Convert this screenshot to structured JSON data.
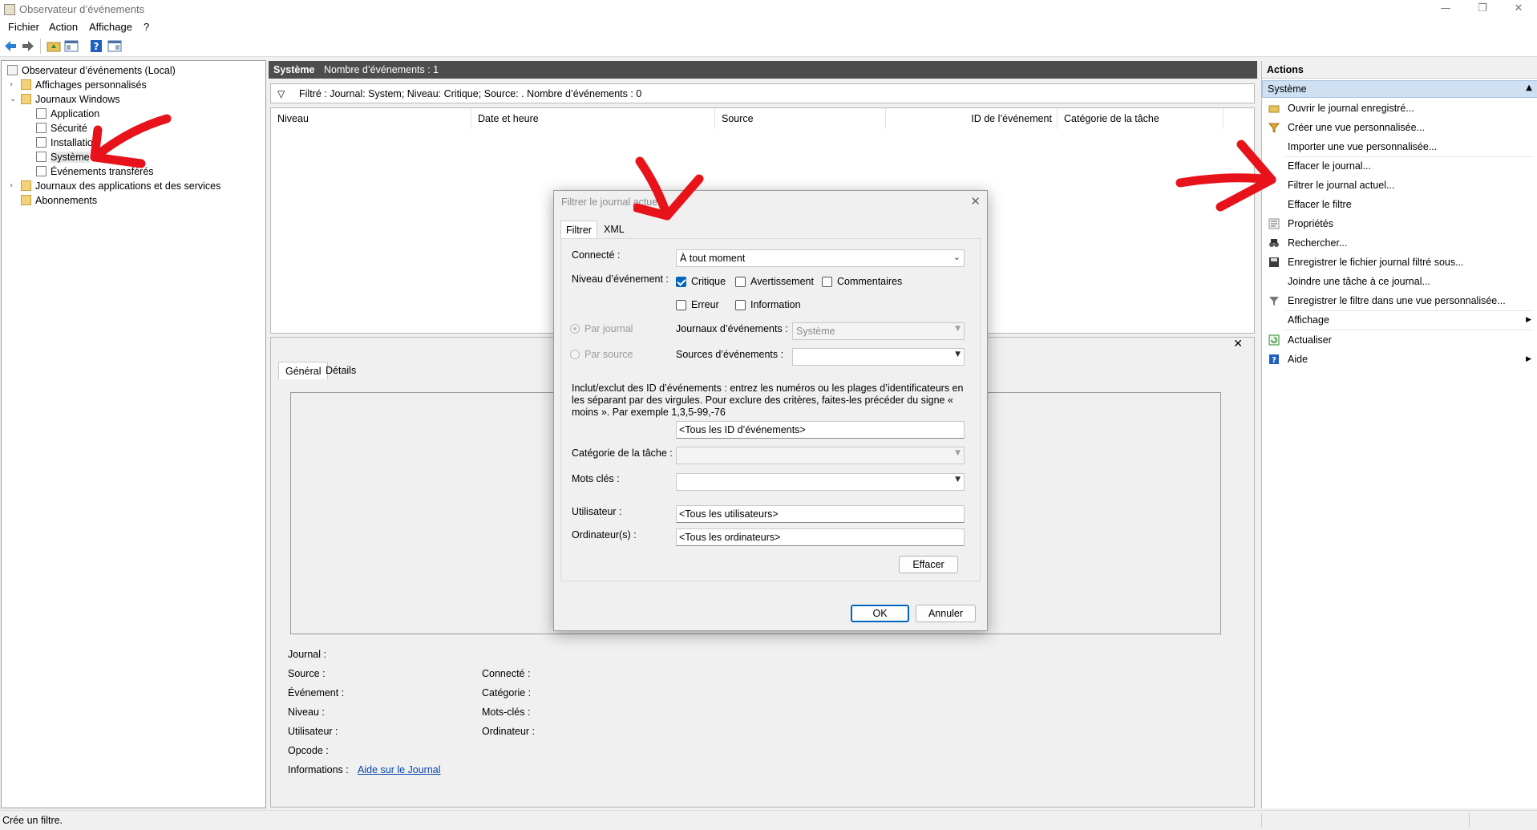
{
  "window": {
    "title": "Observateur d’événements",
    "min": "—",
    "max": "❐",
    "close": "✕"
  },
  "menu": [
    "Fichier",
    "Action",
    "Affichage",
    "?"
  ],
  "tree": {
    "root": "Observateur d’événements (Local)",
    "custom_views": "Affichages personnalisés",
    "windows_logs": "Journaux Windows",
    "logs": [
      "Application",
      "Sécurité",
      "Installation",
      "Système",
      "Événements transférés"
    ],
    "app_services": "Journaux des applications et des services",
    "subscriptions": "Abonnements"
  },
  "center": {
    "title": "Système",
    "count": "Nombre d’événements : 1",
    "filter_text": "Filtré : Journal: System; Niveau: Critique; Source: . Nombre d’événements : 0",
    "columns": [
      "Niveau",
      "Date et heure",
      "Source",
      "ID de l’événement",
      "Catégorie de la tâche"
    ]
  },
  "detail": {
    "tabs": [
      "Général",
      "Détails"
    ],
    "close": "✕",
    "fields_left": [
      "Journal :",
      "Source :",
      "Événement :",
      "Niveau :",
      "Utilisateur :",
      "Opcode :",
      "Informations :"
    ],
    "fields_right": [
      "Connecté :",
      "Catégorie :",
      "Mots-clés :",
      "Ordinateur :"
    ],
    "help_link": "Aide sur le Journal"
  },
  "actions": {
    "header": "Actions",
    "section": "Système",
    "items": [
      "Ouvrir le journal enregistré...",
      "Créer une vue personnalisée...",
      "Importer une vue personnalisée...",
      "Effacer le journal...",
      "Filtrer le journal actuel...",
      "Effacer le filtre",
      "Propriétés",
      "Rechercher...",
      "Enregistrer le fichier journal filtré sous...",
      "Joindre une tâche à ce journal...",
      "Enregistrer le filtre dans une vue personnalisée...",
      "Affichage",
      "Actualiser",
      "Aide"
    ]
  },
  "status": {
    "text": "Crée un filtre."
  },
  "dialog": {
    "title": "Filtrer le journal actuel",
    "close": "✕",
    "tabs": [
      "Filtrer",
      "XML"
    ],
    "logged_label": "Connecté :",
    "logged_value": "À tout moment",
    "level_label": "Niveau d’événement :",
    "levels": [
      {
        "label": "Critique",
        "checked": true
      },
      {
        "label": "Avertissement",
        "checked": false
      },
      {
        "label": "Commentaires",
        "checked": false
      },
      {
        "label": "Erreur",
        "checked": false
      },
      {
        "label": "Information",
        "checked": false
      }
    ],
    "by_log": "Par journal",
    "by_source": "Par source",
    "event_logs_label": "Journaux d’événements :",
    "event_logs_value": "Système",
    "event_sources_label": "Sources d’événements :",
    "event_sources_value": "",
    "id_help": "Inclut/exclut des ID d’événements : entrez les numéros ou les plages d’identificateurs en les séparant par des virgules. Pour exclure des critères, faites-les précéder du signe « moins ». Par exemple 1,3,5-99,-76",
    "id_value": "<Tous les ID d’événements>",
    "task_category_label": "Catégorie de la tâche :",
    "keywords_label": "Mots clés :",
    "user_label": "Utilisateur :",
    "user_value": "<Tous les utilisateurs>",
    "computer_label": "Ordinateur(s) :",
    "computer_value": "<Tous les ordinateurs>",
    "clear_button": "Effacer",
    "ok_button": "OK",
    "cancel_button": "Annuler"
  },
  "colors": {
    "accent": "#0067c0",
    "annotation": "#e8121a",
    "header_dark": "#4d4d4d",
    "actions_section": "#cfe0f2"
  }
}
